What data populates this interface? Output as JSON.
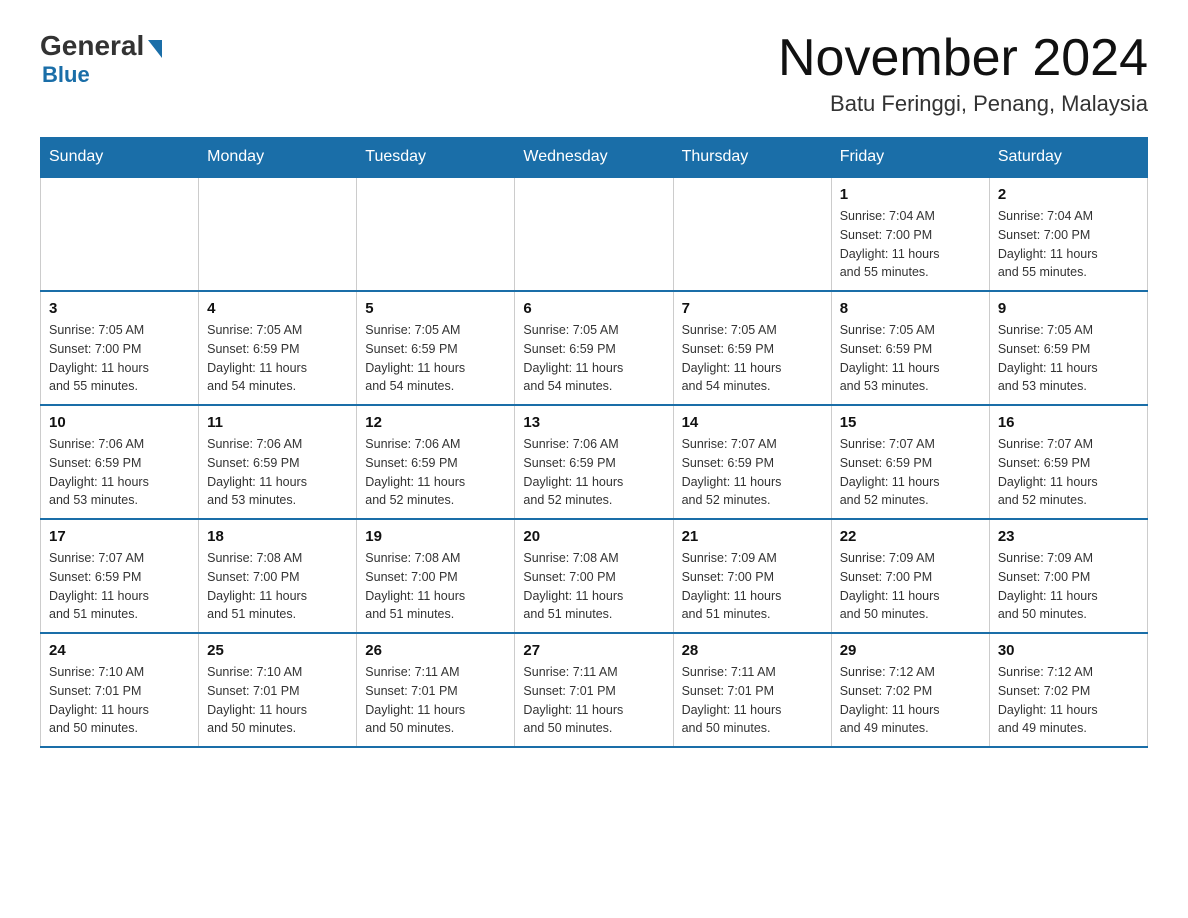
{
  "logo": {
    "general": "General",
    "blue": "Blue"
  },
  "title": "November 2024",
  "subtitle": "Batu Feringgi, Penang, Malaysia",
  "days_of_week": [
    "Sunday",
    "Monday",
    "Tuesday",
    "Wednesday",
    "Thursday",
    "Friday",
    "Saturday"
  ],
  "weeks": [
    [
      {
        "day": "",
        "info": ""
      },
      {
        "day": "",
        "info": ""
      },
      {
        "day": "",
        "info": ""
      },
      {
        "day": "",
        "info": ""
      },
      {
        "day": "",
        "info": ""
      },
      {
        "day": "1",
        "info": "Sunrise: 7:04 AM\nSunset: 7:00 PM\nDaylight: 11 hours\nand 55 minutes."
      },
      {
        "day": "2",
        "info": "Sunrise: 7:04 AM\nSunset: 7:00 PM\nDaylight: 11 hours\nand 55 minutes."
      }
    ],
    [
      {
        "day": "3",
        "info": "Sunrise: 7:05 AM\nSunset: 7:00 PM\nDaylight: 11 hours\nand 55 minutes."
      },
      {
        "day": "4",
        "info": "Sunrise: 7:05 AM\nSunset: 6:59 PM\nDaylight: 11 hours\nand 54 minutes."
      },
      {
        "day": "5",
        "info": "Sunrise: 7:05 AM\nSunset: 6:59 PM\nDaylight: 11 hours\nand 54 minutes."
      },
      {
        "day": "6",
        "info": "Sunrise: 7:05 AM\nSunset: 6:59 PM\nDaylight: 11 hours\nand 54 minutes."
      },
      {
        "day": "7",
        "info": "Sunrise: 7:05 AM\nSunset: 6:59 PM\nDaylight: 11 hours\nand 54 minutes."
      },
      {
        "day": "8",
        "info": "Sunrise: 7:05 AM\nSunset: 6:59 PM\nDaylight: 11 hours\nand 53 minutes."
      },
      {
        "day": "9",
        "info": "Sunrise: 7:05 AM\nSunset: 6:59 PM\nDaylight: 11 hours\nand 53 minutes."
      }
    ],
    [
      {
        "day": "10",
        "info": "Sunrise: 7:06 AM\nSunset: 6:59 PM\nDaylight: 11 hours\nand 53 minutes."
      },
      {
        "day": "11",
        "info": "Sunrise: 7:06 AM\nSunset: 6:59 PM\nDaylight: 11 hours\nand 53 minutes."
      },
      {
        "day": "12",
        "info": "Sunrise: 7:06 AM\nSunset: 6:59 PM\nDaylight: 11 hours\nand 52 minutes."
      },
      {
        "day": "13",
        "info": "Sunrise: 7:06 AM\nSunset: 6:59 PM\nDaylight: 11 hours\nand 52 minutes."
      },
      {
        "day": "14",
        "info": "Sunrise: 7:07 AM\nSunset: 6:59 PM\nDaylight: 11 hours\nand 52 minutes."
      },
      {
        "day": "15",
        "info": "Sunrise: 7:07 AM\nSunset: 6:59 PM\nDaylight: 11 hours\nand 52 minutes."
      },
      {
        "day": "16",
        "info": "Sunrise: 7:07 AM\nSunset: 6:59 PM\nDaylight: 11 hours\nand 52 minutes."
      }
    ],
    [
      {
        "day": "17",
        "info": "Sunrise: 7:07 AM\nSunset: 6:59 PM\nDaylight: 11 hours\nand 51 minutes."
      },
      {
        "day": "18",
        "info": "Sunrise: 7:08 AM\nSunset: 7:00 PM\nDaylight: 11 hours\nand 51 minutes."
      },
      {
        "day": "19",
        "info": "Sunrise: 7:08 AM\nSunset: 7:00 PM\nDaylight: 11 hours\nand 51 minutes."
      },
      {
        "day": "20",
        "info": "Sunrise: 7:08 AM\nSunset: 7:00 PM\nDaylight: 11 hours\nand 51 minutes."
      },
      {
        "day": "21",
        "info": "Sunrise: 7:09 AM\nSunset: 7:00 PM\nDaylight: 11 hours\nand 51 minutes."
      },
      {
        "day": "22",
        "info": "Sunrise: 7:09 AM\nSunset: 7:00 PM\nDaylight: 11 hours\nand 50 minutes."
      },
      {
        "day": "23",
        "info": "Sunrise: 7:09 AM\nSunset: 7:00 PM\nDaylight: 11 hours\nand 50 minutes."
      }
    ],
    [
      {
        "day": "24",
        "info": "Sunrise: 7:10 AM\nSunset: 7:01 PM\nDaylight: 11 hours\nand 50 minutes."
      },
      {
        "day": "25",
        "info": "Sunrise: 7:10 AM\nSunset: 7:01 PM\nDaylight: 11 hours\nand 50 minutes."
      },
      {
        "day": "26",
        "info": "Sunrise: 7:11 AM\nSunset: 7:01 PM\nDaylight: 11 hours\nand 50 minutes."
      },
      {
        "day": "27",
        "info": "Sunrise: 7:11 AM\nSunset: 7:01 PM\nDaylight: 11 hours\nand 50 minutes."
      },
      {
        "day": "28",
        "info": "Sunrise: 7:11 AM\nSunset: 7:01 PM\nDaylight: 11 hours\nand 50 minutes."
      },
      {
        "day": "29",
        "info": "Sunrise: 7:12 AM\nSunset: 7:02 PM\nDaylight: 11 hours\nand 49 minutes."
      },
      {
        "day": "30",
        "info": "Sunrise: 7:12 AM\nSunset: 7:02 PM\nDaylight: 11 hours\nand 49 minutes."
      }
    ]
  ]
}
